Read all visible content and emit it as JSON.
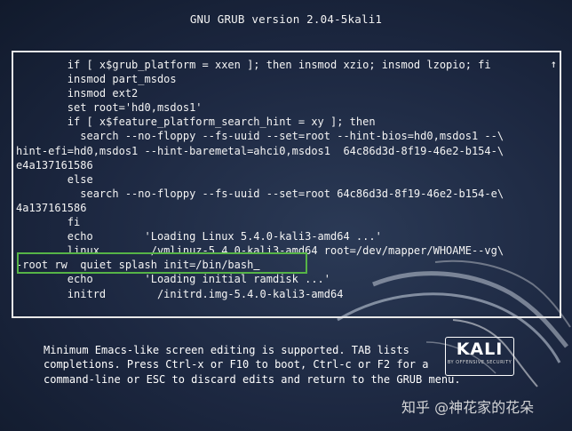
{
  "header": {
    "title": "GNU GRUB  version 2.04-5kali1"
  },
  "editor": {
    "scroll_indicator": "↑",
    "lines": [
      "        if [ x$grub_platform = xxen ]; then insmod xzio; insmod lzopio; fi",
      "        insmod part_msdos",
      "        insmod ext2",
      "        set root='hd0,msdos1'",
      "        if [ x$feature_platform_search_hint = xy ]; then",
      "          search --no-floppy --fs-uuid --set=root --hint-bios=hd0,msdos1 --\\",
      "hint-efi=hd0,msdos1 --hint-baremetal=ahci0,msdos1  64c86d3d-8f19-46e2-b154-\\",
      "e4a137161586",
      "        else",
      "          search --no-floppy --fs-uuid --set=root 64c86d3d-8f19-46e2-b154-e\\",
      "4a137161586",
      "        fi",
      "        echo        'Loading Linux 5.4.0-kali3-amd64 ...'",
      "        linux        /vmlinuz-5.4.0-kali3-amd64 root=/dev/mapper/WHOAME--vg\\"
    ],
    "edited_line": "-root rw  quiet splash init=/bin/bash",
    "lines_after": [
      "        echo        'Loading initial ramdisk ...'",
      "        initrd        /initrd.img-5.4.0-kali3-amd64"
    ]
  },
  "help": {
    "lines": [
      "Minimum Emacs-like screen editing is supported. TAB lists",
      "completions. Press Ctrl-x or F10 to boot, Ctrl-c or F2 for a",
      "command-line or ESC to discard edits and return to the GRUB menu."
    ]
  },
  "logo": {
    "name": "KALI",
    "tagline": "BY OFFENSIVE SECURITY"
  },
  "watermark": {
    "text": "知乎 @神花家的花朵"
  },
  "colors": {
    "background": "#1c2740",
    "highlight_box": "#56b447",
    "text": "#ffffff"
  }
}
